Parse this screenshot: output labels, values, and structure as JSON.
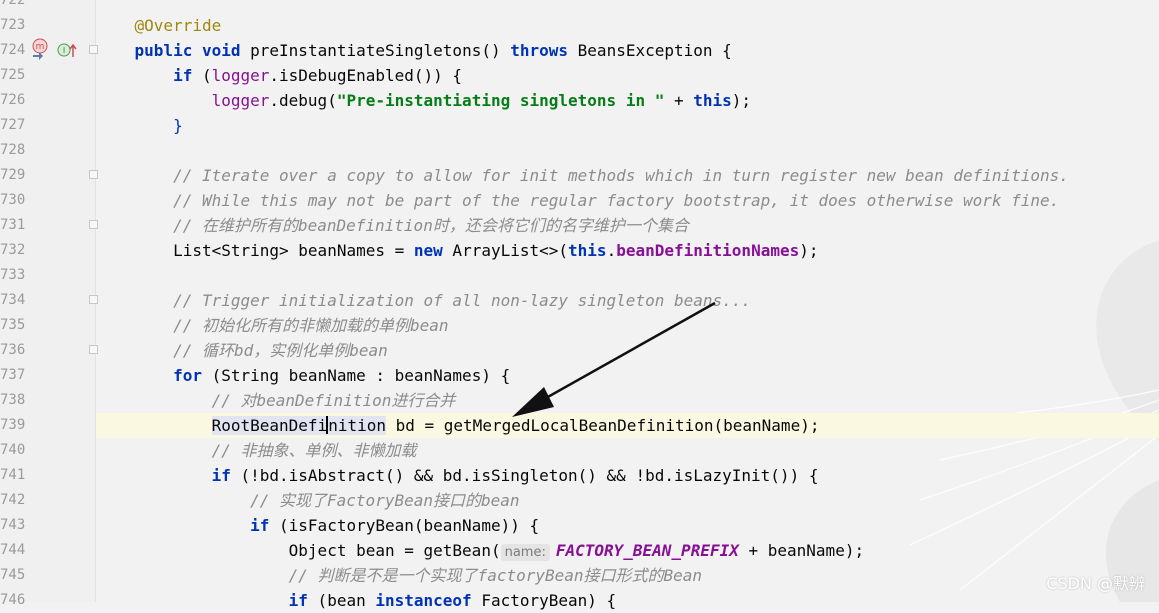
{
  "editor": {
    "line_numbers": [
      "722",
      "723",
      "724",
      "725",
      "726",
      "727",
      "728",
      "729",
      "730",
      "731",
      "732",
      "733",
      "734",
      "735",
      "736",
      "737",
      "738",
      "739",
      "740",
      "741",
      "742",
      "743",
      "744",
      "745",
      "746"
    ],
    "inlay_hint": "name:",
    "code": {
      "l723": "@Override",
      "l724_a": "public",
      "l724_b": "void",
      "l724_c": "preInstantiateSingletons() ",
      "l724_d": "throws",
      "l724_e": " BeansException {",
      "l725_a": "if",
      "l725_b": " (",
      "l725_c": "logger",
      "l725_d": ".isDebugEnabled()) {",
      "l726_a": "logger",
      "l726_b": ".debug(",
      "l726_c": "\"Pre-instantiating singletons in \"",
      "l726_d": " + ",
      "l726_e": "this",
      "l726_f": ");",
      "l727": "}",
      "l729": "// Iterate over a copy to allow for init methods which in turn register new bean definitions.",
      "l730": "// While this may not be part of the regular factory bootstrap, it does otherwise work fine.",
      "l731": "// 在维护所有的beanDefinition时，还会将它们的名字维护一个集合",
      "l732_a": "List<String> beanNames = ",
      "l732_b": "new",
      "l732_c": " ArrayList<>(",
      "l732_d": "this",
      "l732_e": ".",
      "l732_f": "beanDefinitionNames",
      "l732_g": ");",
      "l734": "// Trigger initialization of all non-lazy singleton beans...",
      "l735": "// 初始化所有的非懒加载的单例bean",
      "l736": "// 循环bd，实例化单例bean",
      "l737_a": "for",
      "l737_b": " (String beanName : beanNames) {",
      "l738": "// 对beanDefinition进行合并",
      "l739_a": "RootBeanDefi",
      "l739_b": "nition",
      "l739_c": " bd = getMergedLocalBeanDefinition(beanName);",
      "l740": "// 非抽象、单例、非懒加载",
      "l741_a": "if",
      "l741_b": " (!bd.isAbstract() && bd.isSingleton() && !bd.isLazyInit()) {",
      "l742": "// 实现了FactoryBean接口的bean",
      "l743_a": "if",
      "l743_b": " (isFactoryBean(beanName)) {",
      "l744_a": "Object bean = getBean(",
      "l744_b": "FACTORY_BEAN_PREFIX",
      "l744_c": " + beanName);",
      "l745": "// 判断是不是一个实现了factoryBean接口形式的Bean",
      "l746_a": "if",
      "l746_b": " (bean ",
      "l746_c": "instanceof",
      "l746_d": " FactoryBean) {"
    }
  },
  "gutter_icons": {
    "method_icon": "m",
    "implements_icon": "I"
  },
  "watermark": "CSDN @默辨",
  "colors": {
    "keyword": "#0033b3",
    "string": "#067d17",
    "comment": "#8c8c8c",
    "annotation": "#9e880d",
    "field": "#871094",
    "highlight_line": "#fbf8e1"
  }
}
